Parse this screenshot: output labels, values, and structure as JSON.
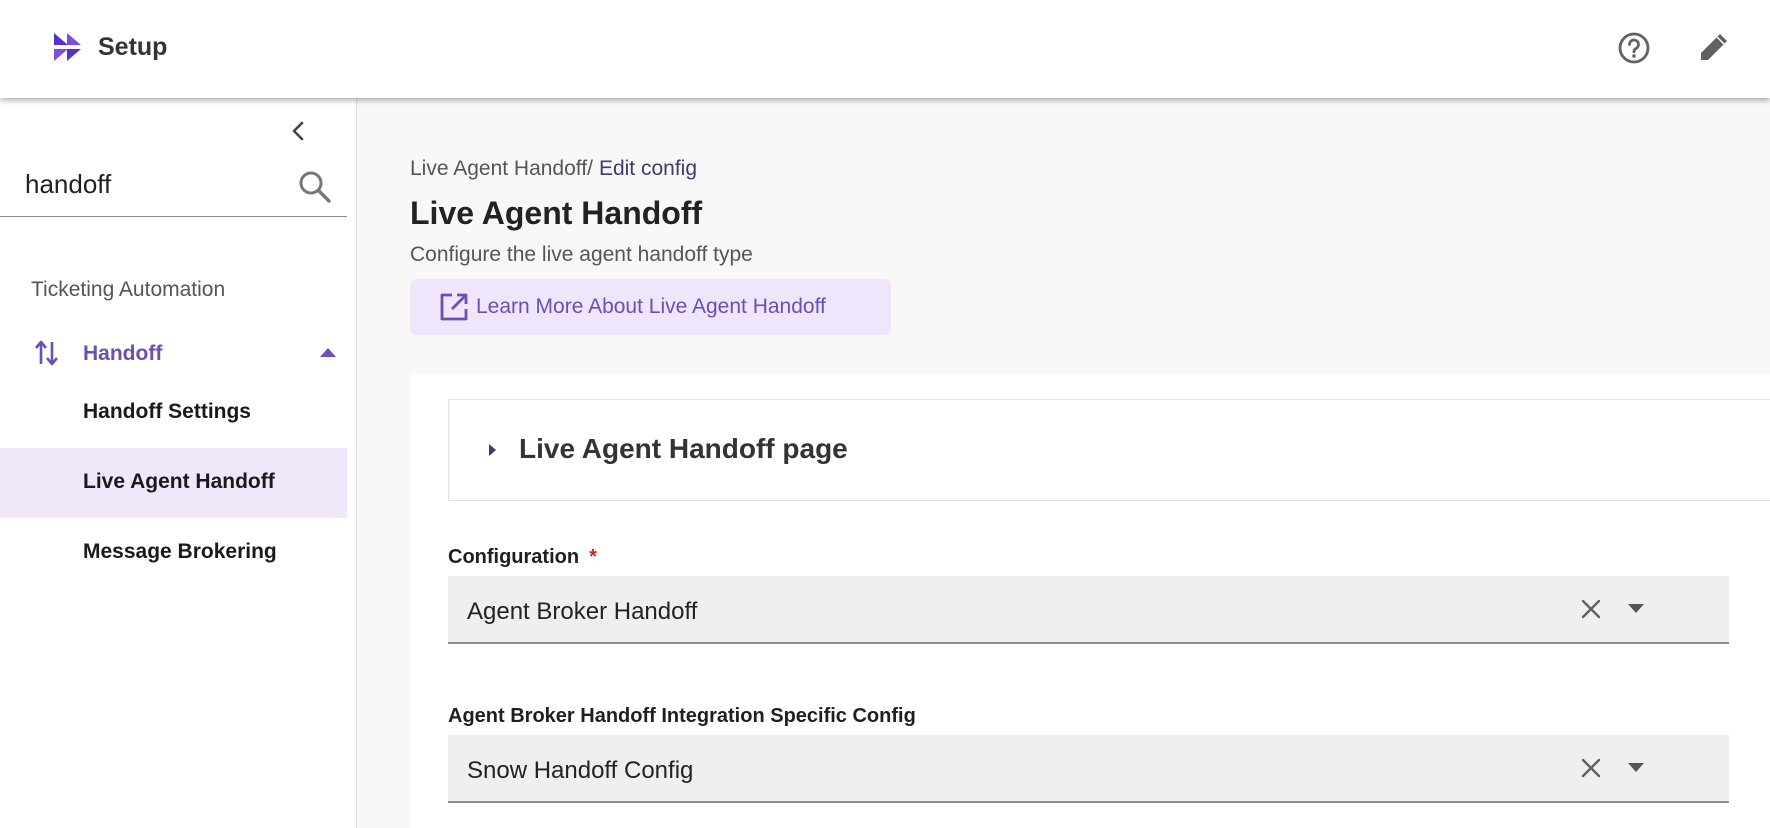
{
  "app": {
    "title": "Setup"
  },
  "sidebar": {
    "search": {
      "value": "handoff"
    },
    "section_label": "Ticketing Automation",
    "group": {
      "label": "Handoff"
    },
    "items": [
      {
        "label": "Handoff Settings"
      },
      {
        "label": "Live Agent Handoff",
        "active": true
      },
      {
        "label": "Message Brokering"
      }
    ]
  },
  "breadcrumb": {
    "parent": "Live Agent Handoff",
    "separator": "/",
    "current": "Edit config"
  },
  "page": {
    "title": "Live Agent Handoff",
    "subtitle": "Configure the live agent handoff type",
    "learn_more": "Learn More About Live Agent Handoff"
  },
  "accordion": {
    "title": "Live Agent Handoff page"
  },
  "form": {
    "configuration": {
      "label": "Configuration",
      "required_mark": "*",
      "value": "Agent Broker Handoff"
    },
    "integration_config": {
      "label": "Agent Broker Handoff Integration Specific Config",
      "value": "Snow Handoff Config"
    }
  },
  "colors": {
    "accent": "#6b4fb3",
    "active_bg": "#f0e7fb",
    "required": "#c62828"
  },
  "icons": [
    "logo-icon",
    "help-icon",
    "pencil-icon",
    "chevron-left-icon",
    "search-icon",
    "swap-vertical-icon",
    "caret-up-icon",
    "external-link-icon",
    "caret-right-icon",
    "close-icon",
    "caret-down-icon"
  ]
}
